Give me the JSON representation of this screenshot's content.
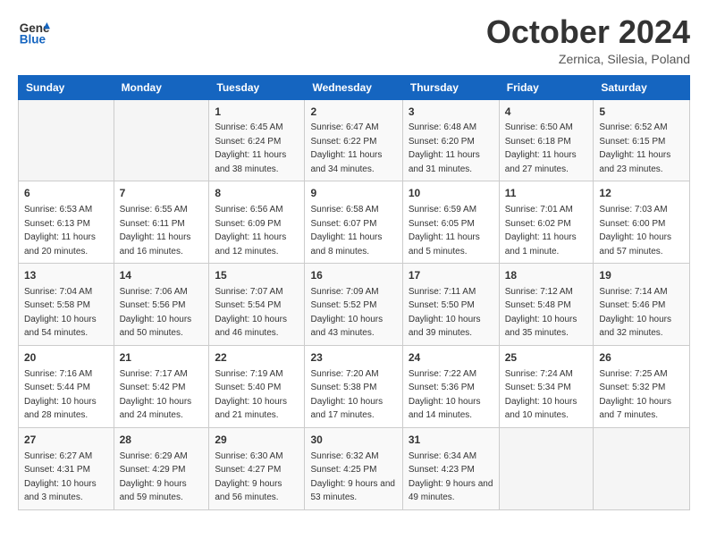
{
  "header": {
    "logo_line1": "General",
    "logo_line2": "Blue",
    "month_title": "October 2024",
    "location": "Zernica, Silesia, Poland"
  },
  "days_of_week": [
    "Sunday",
    "Monday",
    "Tuesday",
    "Wednesday",
    "Thursday",
    "Friday",
    "Saturday"
  ],
  "weeks": [
    [
      {
        "day": "",
        "sunrise": "",
        "sunset": "",
        "daylight": ""
      },
      {
        "day": "",
        "sunrise": "",
        "sunset": "",
        "daylight": ""
      },
      {
        "day": "1",
        "sunrise": "Sunrise: 6:45 AM",
        "sunset": "Sunset: 6:24 PM",
        "daylight": "Daylight: 11 hours and 38 minutes."
      },
      {
        "day": "2",
        "sunrise": "Sunrise: 6:47 AM",
        "sunset": "Sunset: 6:22 PM",
        "daylight": "Daylight: 11 hours and 34 minutes."
      },
      {
        "day": "3",
        "sunrise": "Sunrise: 6:48 AM",
        "sunset": "Sunset: 6:20 PM",
        "daylight": "Daylight: 11 hours and 31 minutes."
      },
      {
        "day": "4",
        "sunrise": "Sunrise: 6:50 AM",
        "sunset": "Sunset: 6:18 PM",
        "daylight": "Daylight: 11 hours and 27 minutes."
      },
      {
        "day": "5",
        "sunrise": "Sunrise: 6:52 AM",
        "sunset": "Sunset: 6:15 PM",
        "daylight": "Daylight: 11 hours and 23 minutes."
      }
    ],
    [
      {
        "day": "6",
        "sunrise": "Sunrise: 6:53 AM",
        "sunset": "Sunset: 6:13 PM",
        "daylight": "Daylight: 11 hours and 20 minutes."
      },
      {
        "day": "7",
        "sunrise": "Sunrise: 6:55 AM",
        "sunset": "Sunset: 6:11 PM",
        "daylight": "Daylight: 11 hours and 16 minutes."
      },
      {
        "day": "8",
        "sunrise": "Sunrise: 6:56 AM",
        "sunset": "Sunset: 6:09 PM",
        "daylight": "Daylight: 11 hours and 12 minutes."
      },
      {
        "day": "9",
        "sunrise": "Sunrise: 6:58 AM",
        "sunset": "Sunset: 6:07 PM",
        "daylight": "Daylight: 11 hours and 8 minutes."
      },
      {
        "day": "10",
        "sunrise": "Sunrise: 6:59 AM",
        "sunset": "Sunset: 6:05 PM",
        "daylight": "Daylight: 11 hours and 5 minutes."
      },
      {
        "day": "11",
        "sunrise": "Sunrise: 7:01 AM",
        "sunset": "Sunset: 6:02 PM",
        "daylight": "Daylight: 11 hours and 1 minute."
      },
      {
        "day": "12",
        "sunrise": "Sunrise: 7:03 AM",
        "sunset": "Sunset: 6:00 PM",
        "daylight": "Daylight: 10 hours and 57 minutes."
      }
    ],
    [
      {
        "day": "13",
        "sunrise": "Sunrise: 7:04 AM",
        "sunset": "Sunset: 5:58 PM",
        "daylight": "Daylight: 10 hours and 54 minutes."
      },
      {
        "day": "14",
        "sunrise": "Sunrise: 7:06 AM",
        "sunset": "Sunset: 5:56 PM",
        "daylight": "Daylight: 10 hours and 50 minutes."
      },
      {
        "day": "15",
        "sunrise": "Sunrise: 7:07 AM",
        "sunset": "Sunset: 5:54 PM",
        "daylight": "Daylight: 10 hours and 46 minutes."
      },
      {
        "day": "16",
        "sunrise": "Sunrise: 7:09 AM",
        "sunset": "Sunset: 5:52 PM",
        "daylight": "Daylight: 10 hours and 43 minutes."
      },
      {
        "day": "17",
        "sunrise": "Sunrise: 7:11 AM",
        "sunset": "Sunset: 5:50 PM",
        "daylight": "Daylight: 10 hours and 39 minutes."
      },
      {
        "day": "18",
        "sunrise": "Sunrise: 7:12 AM",
        "sunset": "Sunset: 5:48 PM",
        "daylight": "Daylight: 10 hours and 35 minutes."
      },
      {
        "day": "19",
        "sunrise": "Sunrise: 7:14 AM",
        "sunset": "Sunset: 5:46 PM",
        "daylight": "Daylight: 10 hours and 32 minutes."
      }
    ],
    [
      {
        "day": "20",
        "sunrise": "Sunrise: 7:16 AM",
        "sunset": "Sunset: 5:44 PM",
        "daylight": "Daylight: 10 hours and 28 minutes."
      },
      {
        "day": "21",
        "sunrise": "Sunrise: 7:17 AM",
        "sunset": "Sunset: 5:42 PM",
        "daylight": "Daylight: 10 hours and 24 minutes."
      },
      {
        "day": "22",
        "sunrise": "Sunrise: 7:19 AM",
        "sunset": "Sunset: 5:40 PM",
        "daylight": "Daylight: 10 hours and 21 minutes."
      },
      {
        "day": "23",
        "sunrise": "Sunrise: 7:20 AM",
        "sunset": "Sunset: 5:38 PM",
        "daylight": "Daylight: 10 hours and 17 minutes."
      },
      {
        "day": "24",
        "sunrise": "Sunrise: 7:22 AM",
        "sunset": "Sunset: 5:36 PM",
        "daylight": "Daylight: 10 hours and 14 minutes."
      },
      {
        "day": "25",
        "sunrise": "Sunrise: 7:24 AM",
        "sunset": "Sunset: 5:34 PM",
        "daylight": "Daylight: 10 hours and 10 minutes."
      },
      {
        "day": "26",
        "sunrise": "Sunrise: 7:25 AM",
        "sunset": "Sunset: 5:32 PM",
        "daylight": "Daylight: 10 hours and 7 minutes."
      }
    ],
    [
      {
        "day": "27",
        "sunrise": "Sunrise: 6:27 AM",
        "sunset": "Sunset: 4:31 PM",
        "daylight": "Daylight: 10 hours and 3 minutes."
      },
      {
        "day": "28",
        "sunrise": "Sunrise: 6:29 AM",
        "sunset": "Sunset: 4:29 PM",
        "daylight": "Daylight: 9 hours and 59 minutes."
      },
      {
        "day": "29",
        "sunrise": "Sunrise: 6:30 AM",
        "sunset": "Sunset: 4:27 PM",
        "daylight": "Daylight: 9 hours and 56 minutes."
      },
      {
        "day": "30",
        "sunrise": "Sunrise: 6:32 AM",
        "sunset": "Sunset: 4:25 PM",
        "daylight": "Daylight: 9 hours and 53 minutes."
      },
      {
        "day": "31",
        "sunrise": "Sunrise: 6:34 AM",
        "sunset": "Sunset: 4:23 PM",
        "daylight": "Daylight: 9 hours and 49 minutes."
      },
      {
        "day": "",
        "sunrise": "",
        "sunset": "",
        "daylight": ""
      },
      {
        "day": "",
        "sunrise": "",
        "sunset": "",
        "daylight": ""
      }
    ]
  ]
}
